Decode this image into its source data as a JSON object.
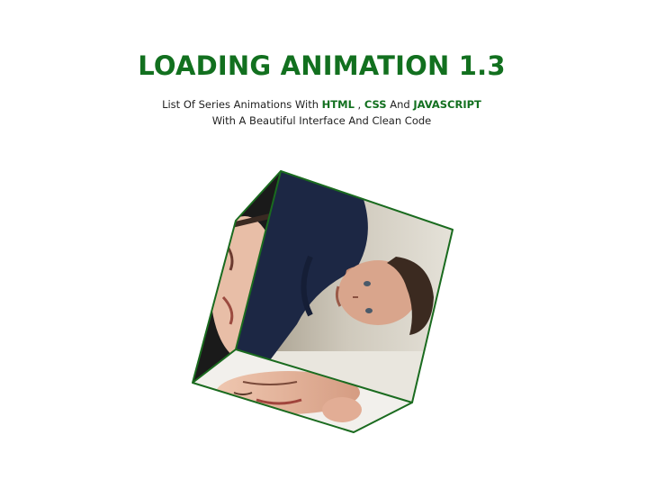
{
  "header": {
    "title": "LOADING ANIMATION 1.3",
    "subtitle_line1": {
      "prefix": "List Of Series Animations With ",
      "html": "HTML",
      "sep1": " , ",
      "css": "CSS",
      "sep2": " And ",
      "js": "JAVASCRIPT"
    },
    "subtitle_line2": "With A Beautiful Interface And Clean Code"
  },
  "colors": {
    "accent": "#12701f",
    "cube_edge": "#1a6b1f",
    "shirt": "#1c2744",
    "skin": "#d9a58c",
    "hair": "#3b2a20",
    "background_wall": "#c8c2b4"
  },
  "cube": {
    "faces": [
      "face-front-photo",
      "face-left-photo",
      "face-bottom-photo"
    ]
  }
}
